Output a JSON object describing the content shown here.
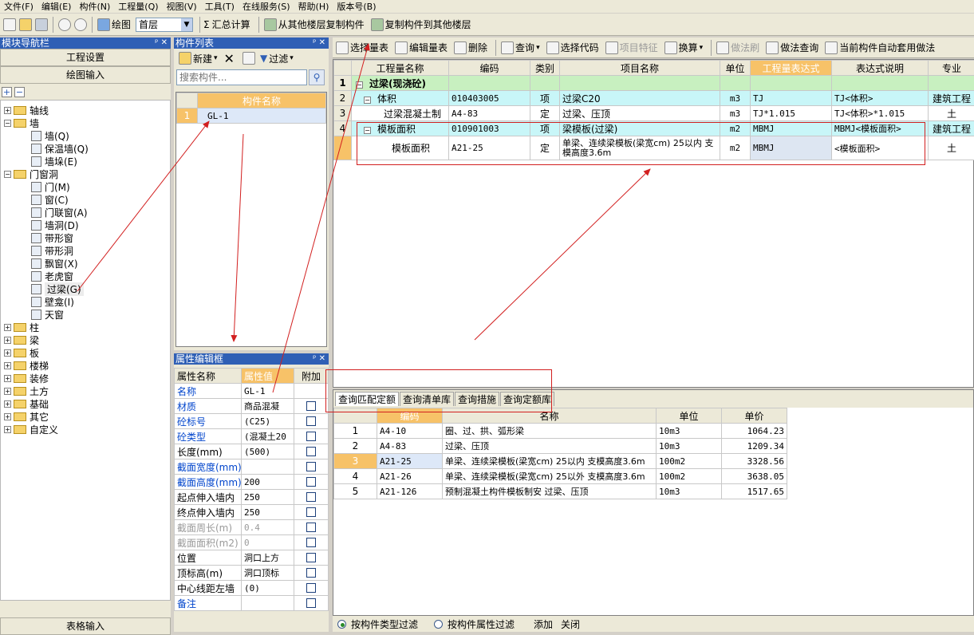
{
  "menu": [
    "文件(F)",
    "编辑(E)",
    "构件(N)",
    "工程量(Q)",
    "视图(V)",
    "工具(T)",
    "在线服务(S)",
    "帮助(H)",
    "版本号(B)"
  ],
  "toolbar": {
    "draw_label": "绘图",
    "floor_value": "首层",
    "sum_label": "汇总计算",
    "copy_from_label": "从其他楼层复制构件",
    "copy_to_label": "复制构件到其他楼层"
  },
  "nav": {
    "title": "模块导航栏",
    "project_settings": "工程设置",
    "draw_input": "绘图输入",
    "table_input": "表格输入",
    "tree": [
      {
        "label": "轴线",
        "level": 0,
        "kind": "folder",
        "sign": "+"
      },
      {
        "label": "墙",
        "level": 0,
        "kind": "folder",
        "sign": "−"
      },
      {
        "label": "墙(Q)",
        "level": 1,
        "kind": "leaf"
      },
      {
        "label": "保温墙(Q)",
        "level": 1,
        "kind": "leaf"
      },
      {
        "label": "墙垛(E)",
        "level": 1,
        "kind": "leaf"
      },
      {
        "label": "门窗洞",
        "level": 0,
        "kind": "folder",
        "sign": "−"
      },
      {
        "label": "门(M)",
        "level": 1,
        "kind": "leaf"
      },
      {
        "label": "窗(C)",
        "level": 1,
        "kind": "leaf"
      },
      {
        "label": "门联窗(A)",
        "level": 1,
        "kind": "leaf"
      },
      {
        "label": "墙洞(D)",
        "level": 1,
        "kind": "leaf"
      },
      {
        "label": "带形窗",
        "level": 1,
        "kind": "leaf"
      },
      {
        "label": "带形洞",
        "level": 1,
        "kind": "leaf"
      },
      {
        "label": "飘窗(X)",
        "level": 1,
        "kind": "leaf"
      },
      {
        "label": "老虎窗",
        "level": 1,
        "kind": "leaf"
      },
      {
        "label": "过梁(G)",
        "level": 1,
        "kind": "leaf",
        "selected": true
      },
      {
        "label": "壁龛(I)",
        "level": 1,
        "kind": "leaf"
      },
      {
        "label": "天窗",
        "level": 1,
        "kind": "leaf"
      },
      {
        "label": "柱",
        "level": 0,
        "kind": "folder",
        "sign": "+"
      },
      {
        "label": "梁",
        "level": 0,
        "kind": "folder",
        "sign": "+"
      },
      {
        "label": "板",
        "level": 0,
        "kind": "folder",
        "sign": "+"
      },
      {
        "label": "楼梯",
        "level": 0,
        "kind": "folder",
        "sign": "+"
      },
      {
        "label": "装修",
        "level": 0,
        "kind": "folder",
        "sign": "+"
      },
      {
        "label": "土方",
        "level": 0,
        "kind": "folder",
        "sign": "+"
      },
      {
        "label": "基础",
        "level": 0,
        "kind": "folder",
        "sign": "+"
      },
      {
        "label": "其它",
        "level": 0,
        "kind": "folder",
        "sign": "+"
      },
      {
        "label": "自定义",
        "level": 0,
        "kind": "folder",
        "sign": "+"
      }
    ]
  },
  "components": {
    "title": "构件列表",
    "new_label": "新建",
    "filter_label": "过滤",
    "search_placeholder": "搜索构件...",
    "column_header": "构件名称",
    "rows": [
      {
        "num": "1",
        "name": "GL-1"
      }
    ]
  },
  "properties": {
    "title": "属性编辑框",
    "headers": [
      "属性名称",
      "属性值",
      "附加"
    ],
    "rows": [
      {
        "name": "名称",
        "value": "GL-1",
        "style": "blue",
        "check": false
      },
      {
        "name": "材质",
        "value": "商品混凝",
        "style": "blue",
        "check": true
      },
      {
        "name": "砼标号",
        "value": "(C25)",
        "style": "blue",
        "check": true
      },
      {
        "name": "砼类型",
        "value": "(混凝土20",
        "style": "blue",
        "check": true
      },
      {
        "name": "长度(mm)",
        "value": "(500)",
        "style": "",
        "check": true
      },
      {
        "name": "截面宽度(mm)",
        "value": "",
        "style": "blue",
        "check": true
      },
      {
        "name": "截面高度(mm)",
        "value": "200",
        "style": "blue",
        "check": true
      },
      {
        "name": "起点伸入墙内",
        "value": "250",
        "style": "",
        "check": true
      },
      {
        "name": "终点伸入墙内",
        "value": "250",
        "style": "",
        "check": true
      },
      {
        "name": "截面周长(m)",
        "value": "0.4",
        "style": "gray",
        "check": true
      },
      {
        "name": "截面面积(m2)",
        "value": "0",
        "style": "gray",
        "check": true
      },
      {
        "name": "位置",
        "value": "洞口上方",
        "style": "",
        "check": true
      },
      {
        "name": "顶标高(m)",
        "value": "洞口顶标",
        "style": "",
        "check": true
      },
      {
        "name": "中心线距左墙",
        "value": "(0)",
        "style": "",
        "check": true
      },
      {
        "name": "备注",
        "value": "",
        "style": "blue",
        "check": true
      }
    ]
  },
  "qty_toolbar": [
    "选择量表",
    "编辑量表",
    "删除",
    "查询",
    "选择代码",
    "项目特征",
    "换算",
    "做法刷",
    "做法查询",
    "当前构件自动套用做法"
  ],
  "qty_grid": {
    "headers": [
      "工程量名称",
      "编码",
      "类别",
      "项目名称",
      "单位",
      "工程量表达式",
      "表达式说明",
      "专业"
    ],
    "rows": [
      {
        "num": "1",
        "sign": "−",
        "name": "过梁(现浇砼)",
        "code": "",
        "type": "",
        "item": "",
        "unit": "",
        "expr": "",
        "desc": "",
        "spec": "",
        "style": "group"
      },
      {
        "num": "2",
        "sign": "−",
        "name": "体积",
        "code": "010403005",
        "type": "项",
        "item": "过梁C20",
        "unit": "m3",
        "expr": "TJ",
        "desc": "TJ<体积>",
        "spec": "建筑工程",
        "style": "item"
      },
      {
        "num": "3",
        "sign": "",
        "name": "过梁混凝土制",
        "code": "A4-83",
        "type": "定",
        "item": "过梁、压顶",
        "unit": "m3",
        "expr": "TJ*1.015",
        "desc": "TJ<体积>*1.015",
        "spec": "土",
        "style": "plain"
      },
      {
        "num": "4",
        "sign": "−",
        "name": "模板面积",
        "code": "010901003",
        "type": "项",
        "item": "梁模板(过梁)",
        "unit": "m2",
        "expr": "MBMJ",
        "desc": "MBMJ<模板面积>",
        "spec": "建筑工程",
        "style": "item"
      },
      {
        "num": "",
        "sign": "",
        "name": "模板面积",
        "code": "A21-25",
        "type": "定",
        "item": "单梁、连续梁模板(梁宽cm) 25以内 支模高度3.6m",
        "unit": "m2",
        "expr": "MBMJ",
        "desc": "<模板面积>",
        "spec": "土",
        "style": "tall"
      }
    ]
  },
  "query": {
    "tabs": [
      "查询匹配定额",
      "查询清单库",
      "查询措施",
      "查询定额库"
    ],
    "headers": [
      "编码",
      "名称",
      "单位",
      "单价"
    ],
    "rows": [
      {
        "num": "1",
        "code": "A4-10",
        "name": "圈、过、拱、弧形梁",
        "unit": "10m3",
        "price": "1064.23"
      },
      {
        "num": "2",
        "code": "A4-83",
        "name": "过梁、压顶",
        "unit": "10m3",
        "price": "1209.34"
      },
      {
        "num": "3",
        "code": "A21-25",
        "name": "单梁、连续梁模板(梁宽cm) 25以内 支模高度3.6m",
        "unit": "100m2",
        "price": "3328.56",
        "selected": true
      },
      {
        "num": "4",
        "code": "A21-26",
        "name": "单梁、连续梁模板(梁宽cm) 25以外 支模高度3.6m",
        "unit": "100m2",
        "price": "3638.05"
      },
      {
        "num": "5",
        "code": "A21-126",
        "name": "预制混凝土构件模板制安 过梁、压顶",
        "unit": "10m3",
        "price": "1517.65"
      }
    ]
  },
  "bottom": {
    "filter_type": "按构件类型过滤",
    "filter_attr": "按构件属性过滤",
    "add": "添加",
    "close": "关闭"
  },
  "colors": {
    "title_bar": "#2f5fb5",
    "highlight_header": "#f7c268",
    "group_row": "#c8f0c0",
    "item_row": "#c8f6f8",
    "annotation": "#d21f1f"
  }
}
